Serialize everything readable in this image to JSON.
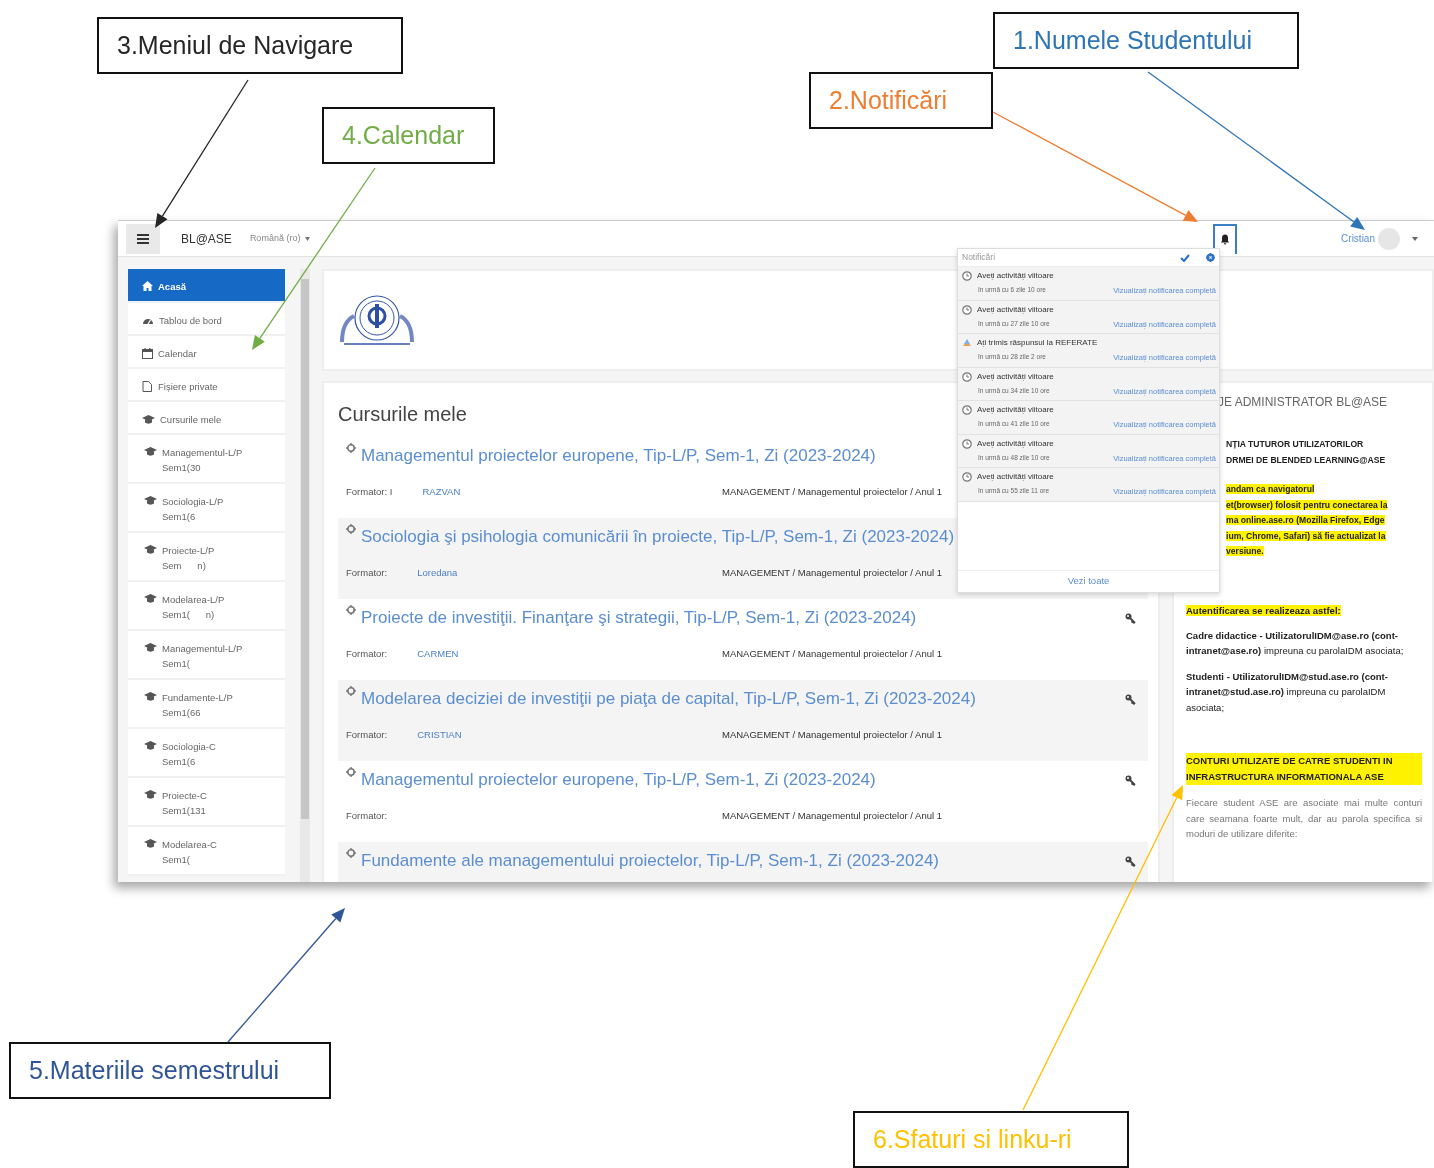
{
  "annotations": [
    {
      "label": "1.Numele Studentului",
      "color": "#2e75b6"
    },
    {
      "label": "2.Notificări",
      "color": "#ed7d31"
    },
    {
      "label": "3.Meniul de Navigare",
      "color": "#262626"
    },
    {
      "label": "4.Calendar",
      "color": "#70ad47"
    },
    {
      "label": "5.Materiile semestrului",
      "color": "#2f5597"
    },
    {
      "label": "6.Sfaturi  si  linku-ri",
      "color": "#ffc000"
    }
  ],
  "navbar": {
    "brand": "BL@ASE",
    "language": "Română (ro)",
    "user_name": "Cristian",
    "bell_focused": true
  },
  "sidebar": {
    "items": [
      {
        "kind": "home",
        "label": "Acasă",
        "selected": true
      },
      {
        "kind": "dashboard",
        "label": "Tablou de bord",
        "selected": false
      },
      {
        "kind": "calendar",
        "label": "Calendar",
        "selected": false
      },
      {
        "kind": "file",
        "label": "Fișiere private",
        "selected": false
      },
      {
        "kind": "courses",
        "label": "Cursurile mele",
        "selected": false
      },
      {
        "kind": "course",
        "label": "Managementul-L/P",
        "sublabel": "Sem1(30",
        "selected": false
      },
      {
        "kind": "course",
        "label": "Sociologia-L/P",
        "sublabel": "Sem1(6",
        "selected": false
      },
      {
        "kind": "course",
        "label": "Proiecte-L/P",
        "sublabel": "Sem      n)",
        "selected": false
      },
      {
        "kind": "course",
        "label": "Modelarea-L/P",
        "sublabel": "Sem1(      n)",
        "selected": false
      },
      {
        "kind": "course",
        "label": "Managementul-L/P",
        "sublabel": "Sem1(",
        "selected": false
      },
      {
        "kind": "course",
        "label": "Fundamente-L/P",
        "sublabel": "Sem1(66",
        "selected": false
      },
      {
        "kind": "course",
        "label": "Sociologia-C",
        "sublabel": "Sem1(6",
        "selected": false
      },
      {
        "kind": "course",
        "label": "Proiecte-C",
        "sublabel": "Sem1(131",
        "selected": false
      },
      {
        "kind": "course",
        "label": "Modelarea-C",
        "sublabel": "Sem1(",
        "selected": false
      }
    ]
  },
  "main": {
    "heading": "Cursurile mele",
    "courses": [
      {
        "title": "Managementul proiectelor europene, Tip-L/P, Sem-1, Zi (2023-2024)",
        "formator": "Formator: I",
        "teacher": "RAZVAN",
        "category": "MANAGEMENT / Managementul proiectelor / Anul 1",
        "key_icon": false
      },
      {
        "title": "Sociologia şi psihologia comunicării în proiecte, Tip-L/P, Sem-1, Zi (2023-2024)",
        "formator": "Formator:",
        "teacher": "Loredana",
        "category": "MANAGEMENT / Managementul proiectelor / Anul 1",
        "key_icon": false
      },
      {
        "title": "Proiecte de investiţii. Finanţare şi strategii, Tip-L/P, Sem-1, Zi (2023-2024)",
        "formator": "Formator:",
        "teacher": "CARMEN",
        "category": "MANAGEMENT / Managementul proiectelor / Anul 1",
        "key_icon": true
      },
      {
        "title": "Modelarea deciziei de investiţii pe piaţa de capital, Tip-L/P, Sem-1, Zi (2023-2024)",
        "formator": "Formator:",
        "teacher": "CRISTIAN",
        "category": "MANAGEMENT / Managementul proiectelor / Anul 1",
        "key_icon": true
      },
      {
        "title": "Managementul proiectelor europene, Tip-L/P, Sem-1, Zi (2023-2024)",
        "formator": "Formator:",
        "category": "MANAGEMENT / Managementul proiectelor / Anul 1",
        "key_icon": true
      },
      {
        "title": "Fundamente ale managementului proiectelor, Tip-L/P, Sem-1, Zi (2023-2024)",
        "key_icon": true
      }
    ]
  },
  "notifications": {
    "title": "Notificări",
    "footer": "Vezi toate",
    "items": [
      {
        "kind": "event",
        "text": "Aveți activități viitoare",
        "time": "în urmă cu 6 zile 10 ore",
        "link": "Vizualizați notificarea completă"
      },
      {
        "kind": "event",
        "text": "Aveți activități viitoare",
        "time": "în urmă cu 27 zile 10 ore",
        "link": "Vizualizați notificarea completă"
      },
      {
        "kind": "submission",
        "text": "Ați trimis răspunsul la REFERATE",
        "time": "în urmă cu 28 zile 2 ore",
        "link": "Vizualizați notificarea completă"
      },
      {
        "kind": "event",
        "text": "Aveți activități viitoare",
        "time": "în urmă cu 34 zile 10 ore",
        "link": "Vizualizați notificarea completă"
      },
      {
        "kind": "event",
        "text": "Aveți activități viitoare",
        "time": "în urmă cu 41 zile 10 ore",
        "link": "Vizualizați notificarea completă"
      },
      {
        "kind": "event",
        "text": "Aveți activități viitoare",
        "time": "în urmă cu 48 zile 10 ore",
        "link": "Vizualizați notificarea completă"
      },
      {
        "kind": "event",
        "text": "Aveți activități viitoare",
        "time": "în urmă cu 55 zile 11 ore",
        "link": "Vizualizați notificarea completă"
      }
    ]
  },
  "announcement": {
    "title": "JE ADMINISTRATOR BL@ASE",
    "blocks": [
      {
        "kind": "cut",
        "text": "NȚIA TUTUROR UTILIZATORILOR",
        "highlight": false
      },
      {
        "kind": "cut",
        "text": "DRMEI DE BLENDED LEARNING@ASE",
        "highlight": false
      },
      {
        "kind": "cut",
        "text": "andam ca navigatorul",
        "highlight": true
      },
      {
        "kind": "cut",
        "text": "et(browser) folosit pentru conectarea la",
        "highlight": true
      },
      {
        "kind": "cut",
        "text": "ma online.ase.ro (Mozilla Firefox, Edge",
        "highlight": true
      },
      {
        "kind": "cut",
        "text": "ium, Chrome, Safari) să fie actualizat la",
        "highlight": true
      },
      {
        "kind": "cut",
        "text": "versiune.",
        "highlight": true
      },
      {
        "kind": "bold",
        "text": "Autentificarea se realizeaza astfel:",
        "highlight": true
      },
      {
        "kind": "text",
        "text": "**Cadre didactice - UtilizatorulIDM@ase.ro (cont-intranet@ase.ro)** impreuna cu parolaIDM asociata;",
        "highlight": false
      },
      {
        "kind": "text",
        "text": "**Studenti - UtilizatorulIDM@stud.ase.ro (cont-intranet@stud.ase.ro)** impreuna cu parolaIDM asociata;",
        "highlight": false
      },
      {
        "kind": "caps",
        "text": "CONTURI UTILIZATE DE CATRE STUDENTI IN INFRASTRUCTURA INFORMATIONALA ASE",
        "highlight": true
      },
      {
        "kind": "grey",
        "text": "Fiecare student ASE are asociate  mai multe conturi care seamana foarte mult, dar au parola specifica si moduri de utilizare diferite:",
        "highlight": false
      }
    ]
  }
}
